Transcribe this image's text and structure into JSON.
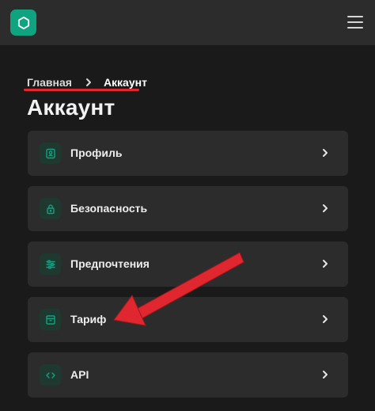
{
  "app": {
    "logo_icon": "openai-logo-icon",
    "menu_icon": "hamburger-menu-icon",
    "brand_color": "#10a37f"
  },
  "breadcrumb": {
    "home": "Главная",
    "separator_icon": "chevron-right-icon",
    "current": "Аккаунт"
  },
  "page": {
    "title": "Аккаунт"
  },
  "menu": {
    "items": [
      {
        "label": "Профиль",
        "icon": "profile-card-icon"
      },
      {
        "label": "Безопасность",
        "icon": "lock-icon"
      },
      {
        "label": "Предпочтения",
        "icon": "sliders-icon"
      },
      {
        "label": "Тариф",
        "icon": "package-box-icon"
      },
      {
        "label": "API",
        "icon": "code-icon"
      }
    ]
  },
  "annotation": {
    "underline_color": "#e0262e",
    "arrow_color": "#e0262e"
  }
}
